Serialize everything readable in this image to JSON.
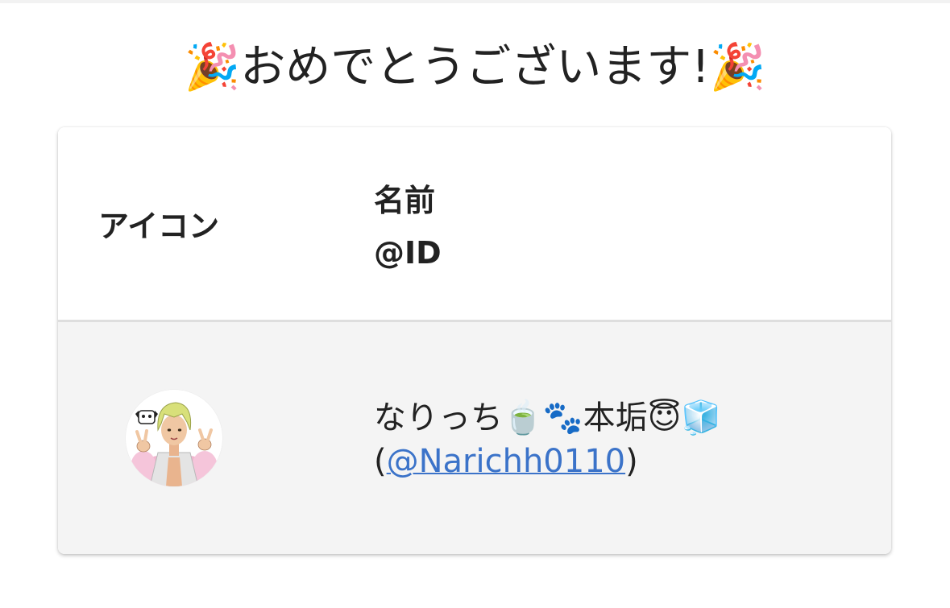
{
  "title": {
    "prefix_emoji": "🎉",
    "text": "おめでとうございます!",
    "suffix_emoji": "🎉"
  },
  "table": {
    "header": {
      "icon_label": "アイコン",
      "name_label": "名前",
      "id_label": "@ID"
    },
    "rows": [
      {
        "name": "なりっち🍵🐾本垢😇🧊",
        "id_open": "(",
        "id_handle": "@Narichh0110",
        "id_close": ")"
      }
    ]
  },
  "colors": {
    "link": "#3b73c9",
    "row_background": "#f4f4f4",
    "text": "#222222"
  },
  "icons": {
    "avatar": "user-avatar-anime-character"
  }
}
